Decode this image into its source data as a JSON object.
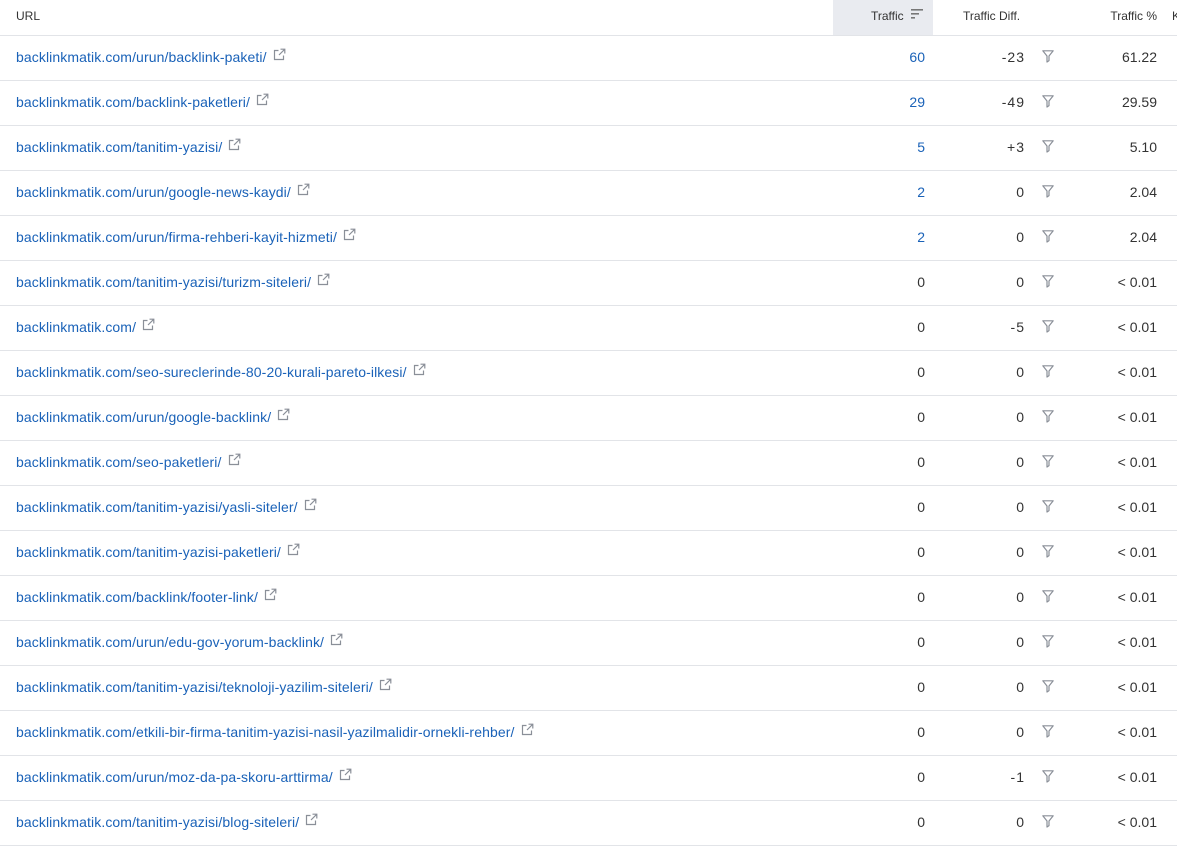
{
  "table": {
    "headers": {
      "url": "URL",
      "traffic": "Traffic",
      "traffic_diff": "Traffic Diff.",
      "traffic_pct": "Traffic %",
      "k": "K"
    },
    "rows": [
      {
        "url": "backlinkmatik.com/urun/backlink-paketi/",
        "traffic": "60",
        "diff": "-23",
        "pct": "61.22",
        "traffic_link": true
      },
      {
        "url": "backlinkmatik.com/backlink-paketleri/",
        "traffic": "29",
        "diff": "-49",
        "pct": "29.59",
        "traffic_link": true
      },
      {
        "url": "backlinkmatik.com/tanitim-yazisi/",
        "traffic": "5",
        "diff": "+3",
        "pct": "5.10",
        "traffic_link": true
      },
      {
        "url": "backlinkmatik.com/urun/google-news-kaydi/",
        "traffic": "2",
        "diff": "0",
        "pct": "2.04",
        "traffic_link": true
      },
      {
        "url": "backlinkmatik.com/urun/firma-rehberi-kayit-hizmeti/",
        "traffic": "2",
        "diff": "0",
        "pct": "2.04",
        "traffic_link": true
      },
      {
        "url": "backlinkmatik.com/tanitim-yazisi/turizm-siteleri/",
        "traffic": "0",
        "diff": "0",
        "pct": "< 0.01",
        "traffic_link": false
      },
      {
        "url": "backlinkmatik.com/",
        "traffic": "0",
        "diff": "-5",
        "pct": "< 0.01",
        "traffic_link": false
      },
      {
        "url": "backlinkmatik.com/seo-sureclerinde-80-20-kurali-pareto-ilkesi/",
        "traffic": "0",
        "diff": "0",
        "pct": "< 0.01",
        "traffic_link": false
      },
      {
        "url": "backlinkmatik.com/urun/google-backlink/",
        "traffic": "0",
        "diff": "0",
        "pct": "< 0.01",
        "traffic_link": false
      },
      {
        "url": "backlinkmatik.com/seo-paketleri/",
        "traffic": "0",
        "diff": "0",
        "pct": "< 0.01",
        "traffic_link": false
      },
      {
        "url": "backlinkmatik.com/tanitim-yazisi/yasli-siteler/",
        "traffic": "0",
        "diff": "0",
        "pct": "< 0.01",
        "traffic_link": false
      },
      {
        "url": "backlinkmatik.com/tanitim-yazisi-paketleri/",
        "traffic": "0",
        "diff": "0",
        "pct": "< 0.01",
        "traffic_link": false
      },
      {
        "url": "backlinkmatik.com/backlink/footer-link/",
        "traffic": "0",
        "diff": "0",
        "pct": "< 0.01",
        "traffic_link": false
      },
      {
        "url": "backlinkmatik.com/urun/edu-gov-yorum-backlink/",
        "traffic": "0",
        "diff": "0",
        "pct": "< 0.01",
        "traffic_link": false
      },
      {
        "url": "backlinkmatik.com/tanitim-yazisi/teknoloji-yazilim-siteleri/",
        "traffic": "0",
        "diff": "0",
        "pct": "< 0.01",
        "traffic_link": false
      },
      {
        "url": "backlinkmatik.com/etkili-bir-firma-tanitim-yazisi-nasil-yazilmalidir-ornekli-rehber/",
        "traffic": "0",
        "diff": "0",
        "pct": "< 0.01",
        "traffic_link": false
      },
      {
        "url": "backlinkmatik.com/urun/moz-da-pa-skoru-arttirma/",
        "traffic": "0",
        "diff": "-1",
        "pct": "< 0.01",
        "traffic_link": false
      },
      {
        "url": "backlinkmatik.com/tanitim-yazisi/blog-siteleri/",
        "traffic": "0",
        "diff": "0",
        "pct": "< 0.01",
        "traffic_link": false
      }
    ],
    "icons": {
      "sort": "sort-descending-icon",
      "external": "external-link-icon",
      "filter": "filter-icon"
    },
    "colors": {
      "link": "#1a62b8",
      "sorted_header_bg": "#e9ebf0",
      "divider": "#e2e4e8"
    }
  }
}
